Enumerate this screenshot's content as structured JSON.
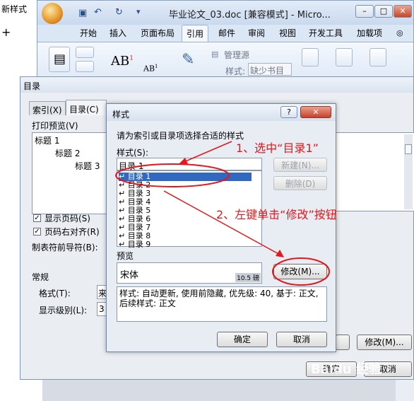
{
  "background": {
    "left_text": "新样式"
  },
  "word": {
    "title": "毕业论文_03.doc [兼容模式] - Micro...",
    "tabs": [
      "开始",
      "插入",
      "页面布局",
      "引用",
      "邮件",
      "审阅",
      "视图",
      "开发工具",
      "加载项"
    ],
    "active_tab": "引用",
    "ribbon": {
      "manage_sources": "管理源",
      "style_label": "样式:",
      "style_value": "缺少书目"
    }
  },
  "toc_dialog": {
    "title": "目录",
    "tabs": [
      "索引(X)",
      "目录(C)"
    ],
    "print_preview_label": "打印预览(V)",
    "preview_lines": [
      "标题 1",
      "标题 2",
      "标题 3"
    ],
    "show_page_numbers": "显示页码(S)",
    "right_align": "页码右对齐(R)",
    "tab_leader": "制表符前导符(B):",
    "general": "常规",
    "format_label": "格式(T):",
    "format_value": "来",
    "levels_label": "显示级别(L):",
    "levels_value": "3",
    "modify_button": "修改(M)...",
    "ok_button": "确定",
    "cancel_button": "取消"
  },
  "style_dialog": {
    "title": "样式",
    "help": "?",
    "close": "✕",
    "instruction": "请为索引或目录项选择合适的样式",
    "styles_label": "样式(S):",
    "styles_value": "目录 1",
    "items": [
      "目录 1",
      "目录 2",
      "目录 3",
      "目录 4",
      "目录 5",
      "目录 6",
      "目录 7",
      "目录 8",
      "目录 9"
    ],
    "new_button": "新建(N)...",
    "delete_button": "删除(D)",
    "preview_label": "预览",
    "preview_font": "宋体",
    "preview_size": "10.5 磅",
    "modify_button": "修改(M)...",
    "description": "样式: 自动更新, 使用前隐藏, 优先级: 40, 基于: 正文, 后续样式: 正文",
    "ok_button": "确定",
    "cancel_button": "取消"
  },
  "annotations": {
    "step1": "1、选中“目录1”",
    "step2": "2、左键单击“修改”按钮",
    "color": "#e6161a"
  },
  "watermark": "Baidu 经验"
}
